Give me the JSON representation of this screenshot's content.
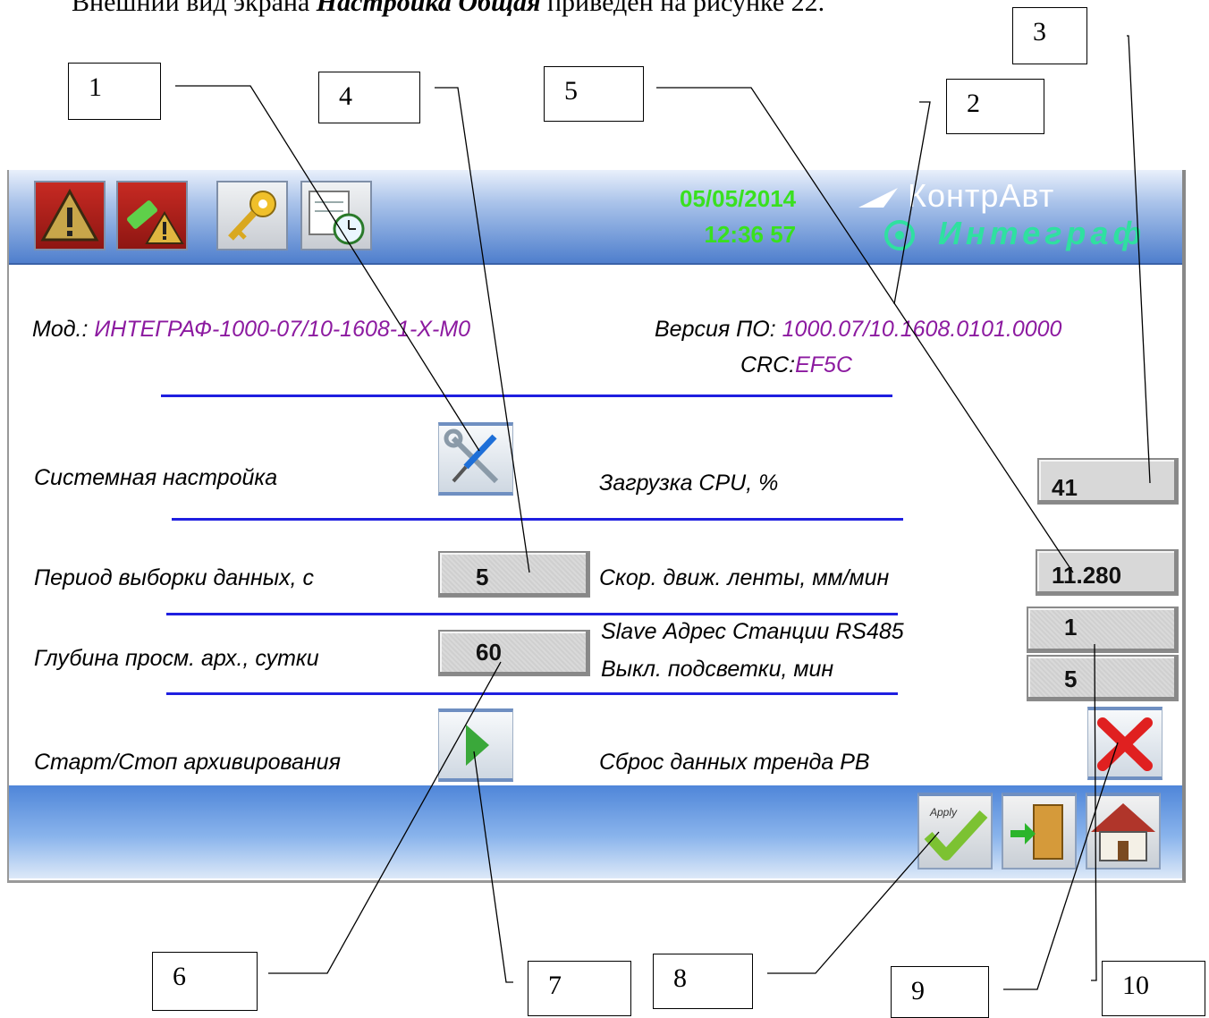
{
  "intro": {
    "prefix": "Внешний вид экрана ",
    "emphasis": "Настройка Общая",
    "suffix": " приведен на рисунке 22."
  },
  "callouts": [
    "1",
    "2",
    "3",
    "4",
    "5",
    "6",
    "7",
    "8",
    "9",
    "10"
  ],
  "header": {
    "date": "05/05/2014",
    "time": "12:36  57",
    "brand_top": "КонтрАвт",
    "brand_bottom": "Интеграф",
    "buttons": [
      "alarm-icon",
      "usb-alarm-icon",
      "key-icon",
      "schedule-icon"
    ]
  },
  "info": {
    "model_label": "Мод.: ",
    "model_value": "ИНТЕГРАФ-1000-07/10-1608-1-Х-М0",
    "version_label": "Версия ПО: ",
    "version_value": "1000.07/10.1608.0101.0000",
    "crc_label": "CRC:",
    "crc_value": "EF5C"
  },
  "settings": {
    "system_setup_label": "Системная настройка",
    "cpu_label": "Загрузка CPU, %",
    "cpu_value": "41",
    "sample_period_label": "Период выборки данных, с",
    "sample_period_value": "5",
    "tape_speed_label": "Скор. движ. ленты, мм/мин",
    "tape_speed_value": "11.280",
    "slave_address_label": "Slave Адрес Станции RS485",
    "slave_address_value": "1",
    "archive_depth_label": "Глубина просм. арх., сутки",
    "archive_depth_value": "60",
    "backlight_off_label": "Выкл. подсветки, мин",
    "backlight_off_value": "5",
    "archive_startstop_label": "Старт/Стоп архивирования",
    "trend_reset_label": "Сброс данных тренда РВ"
  },
  "footer": {
    "apply_text": "Apply",
    "buttons": [
      "apply-icon",
      "exit-icon",
      "home-icon"
    ]
  },
  "colors": {
    "accent_purple": "#8c1aa0",
    "date_green": "#39e01f",
    "divider_blue": "#1f1fe0"
  }
}
